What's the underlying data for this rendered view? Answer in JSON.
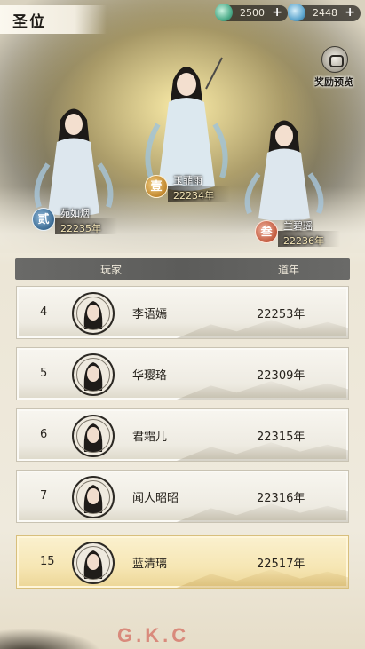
{
  "page": {
    "title": "圣位",
    "watermark": "G.K.C"
  },
  "resources": [
    {
      "name": "jade",
      "icon": "jade-gem-icon",
      "value": "2500",
      "plus": "+"
    },
    {
      "name": "crystal",
      "icon": "blue-crystal-icon",
      "value": "2448",
      "plus": "+"
    }
  ],
  "reward_preview": {
    "label": "奖励预览",
    "icon": "treasure-bag-icon"
  },
  "top3": [
    {
      "rank_glyph": "壹",
      "name": "玉菲雨",
      "years": "22234年"
    },
    {
      "rank_glyph": "贰",
      "name": "苑如烟",
      "years": "22235年"
    },
    {
      "rank_glyph": "叁",
      "name": "兰碧瑶",
      "years": "22236年"
    }
  ],
  "table": {
    "headers": {
      "player": "玩家",
      "years": "道年"
    },
    "rows": [
      {
        "rank": "4",
        "name": "李语嫣",
        "years": "22253年"
      },
      {
        "rank": "5",
        "name": "华璎珞",
        "years": "22309年"
      },
      {
        "rank": "6",
        "name": "君霜儿",
        "years": "22315年"
      },
      {
        "rank": "7",
        "name": "闻人昭昭",
        "years": "22316年"
      }
    ],
    "self_row": {
      "rank": "15",
      "name": "蓝清璃",
      "years": "22517年"
    }
  },
  "colors": {
    "header_bar": "#5c5c5a",
    "self_row": "#f6e6b4",
    "rank1": "#c1872e",
    "rank2": "#3b6b93",
    "rank3": "#c25a3e"
  }
}
